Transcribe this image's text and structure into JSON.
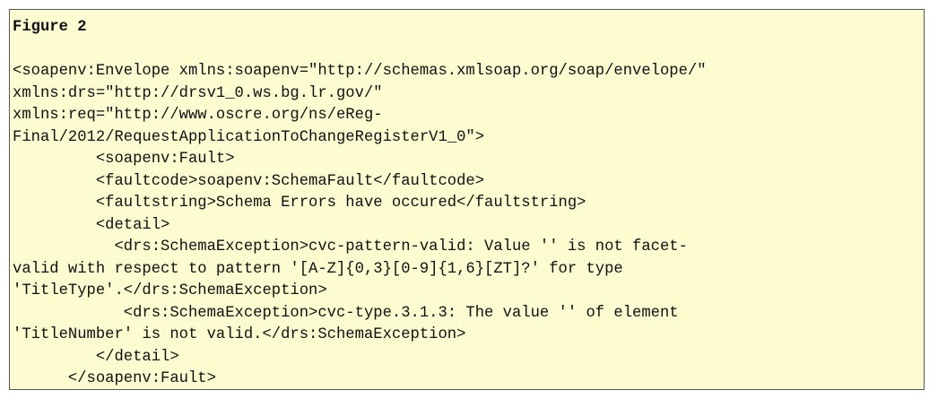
{
  "figure": {
    "title": "Figure 2",
    "lines": [
      "<soapenv:Envelope xmlns:soapenv=\"http://schemas.xmlsoap.org/soap/envelope/\"",
      "xmlns:drs=\"http://drsv1_0.ws.bg.lr.gov/\"",
      "xmlns:req=\"http://www.oscre.org/ns/eReg-",
      "Final/2012/RequestApplicationToChangeRegisterV1_0\">",
      "         <soapenv:Fault>",
      "         <faultcode>soapenv:SchemaFault</faultcode>",
      "         <faultstring>Schema Errors have occured</faultstring>",
      "         <detail>",
      "           <drs:SchemaException>cvc-pattern-valid: Value '' is not facet-",
      "valid with respect to pattern '[A-Z]{0,3}[0-9]{1,6}[ZT]?' for type",
      "'TitleType'.</drs:SchemaException>",
      "            <drs:SchemaException>cvc-type.3.1.3: The value '' of element",
      "'TitleNumber' is not valid.</drs:SchemaException>",
      "         </detail>",
      "      </soapenv:Fault>"
    ]
  },
  "colors": {
    "background": "#fdfbd0",
    "border": "#555555",
    "text": "#111111"
  }
}
